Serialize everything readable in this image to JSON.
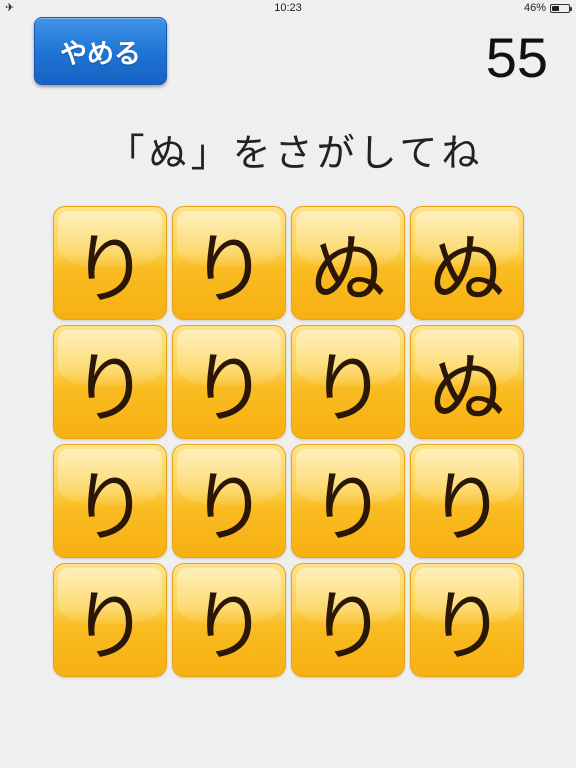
{
  "status_bar": {
    "airplane_icon": "airplane-icon",
    "time": "10:23",
    "battery_text": "46%",
    "battery_level": 0.46
  },
  "header": {
    "quit_label": "やめる",
    "score": "55"
  },
  "instruction": "「ぬ」をさがしてね",
  "colors": {
    "quit_button": "#1e73d4",
    "tile": "#f9bc22",
    "tile_text": "#2a1708"
  },
  "grid": {
    "tiles": [
      "り",
      "り",
      "ぬ",
      "ぬ",
      "り",
      "り",
      "り",
      "ぬ",
      "り",
      "り",
      "り",
      "り",
      "り",
      "り",
      "り",
      "り"
    ]
  }
}
